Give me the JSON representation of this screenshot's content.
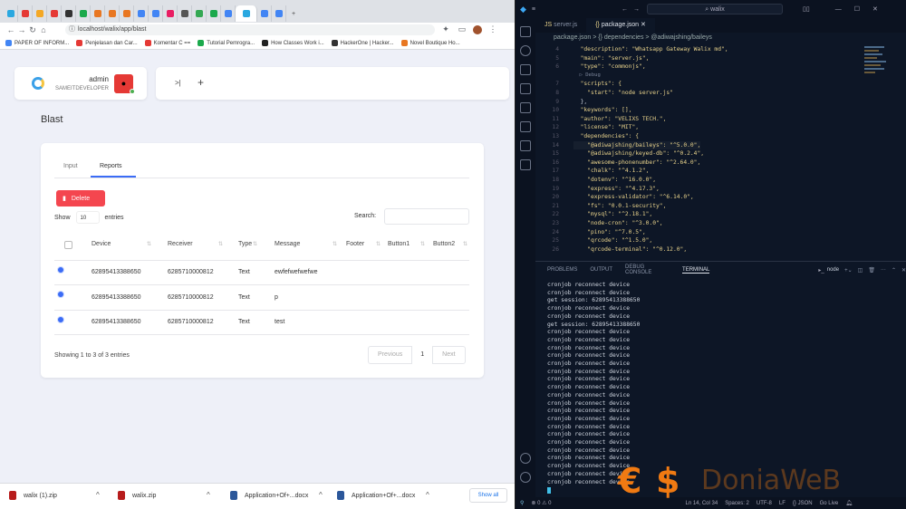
{
  "browser": {
    "tabs": [
      "",
      "",
      "",
      "",
      "",
      "",
      "",
      "",
      "",
      "",
      "",
      "",
      "",
      "",
      "",
      "S",
      "",
      "",
      "",
      ""
    ],
    "url": "localhost/walix/app/blast",
    "bookmarks": [
      "PAPER OF INFORM...",
      "Penjelasan dan Car...",
      "Komentar C ==",
      "Tutorial Pemrogra...",
      "How Classes Work i...",
      "HackerOne | Hacker...",
      "Novel Boutique Ho..."
    ]
  },
  "user": {
    "name": "admin",
    "role": "SAMEITDEVELOPER"
  },
  "actions": {
    "collapse": ">|",
    "add": "+"
  },
  "page": {
    "title": "Blast",
    "tabs": [
      "Input",
      "Reports"
    ],
    "delete_label": "Delete",
    "show_label": "Show",
    "entries_value": "10",
    "entries_label": "entries",
    "search_label": "Search:",
    "columns": [
      "Device",
      "Receiver",
      "Type",
      "Message",
      "Footer",
      "Button1",
      "Button2"
    ],
    "rows": [
      {
        "device": "62895413388650",
        "receiver": "6285710000812",
        "type": "Text",
        "message": "ewfefwefwefwe"
      },
      {
        "device": "62895413388650",
        "receiver": "6285710000812",
        "type": "Text",
        "message": "p"
      },
      {
        "device": "62895413388650",
        "receiver": "6285710000812",
        "type": "Text",
        "message": "test"
      }
    ],
    "info": "Showing 1 to 3 of 3 entries",
    "pager": {
      "prev": "Previous",
      "page": "1",
      "next": "Next"
    }
  },
  "downloads": {
    "items": [
      "walix (1).zip",
      "walix.zip",
      "Application+Of+...docx",
      "Application+Of+...docx"
    ],
    "show_all": "Show all"
  },
  "vscode": {
    "search": "walix",
    "tabs": [
      "server.js",
      "package.json"
    ],
    "breadcrumb": "package.json > {} dependencies > @adiwajshing/baileys",
    "code": [
      {
        "n": "4",
        "t": "  \"description\": \"Whatsapp Gateway Walix md\","
      },
      {
        "n": "5",
        "t": "  \"main\": \"server.js\","
      },
      {
        "n": "6",
        "t": "  \"type\": \"commonjs\","
      },
      {
        "n": "",
        "t": "  ▷ Debug"
      },
      {
        "n": "7",
        "t": "  \"scripts\": {"
      },
      {
        "n": "8",
        "t": "    \"start\": \"node server.js\""
      },
      {
        "n": "9",
        "t": "  },"
      },
      {
        "n": "10",
        "t": "  \"keywords\": [],"
      },
      {
        "n": "11",
        "t": "  \"author\": \"VELIXS TECH.\","
      },
      {
        "n": "12",
        "t": "  \"license\": \"MIT\","
      },
      {
        "n": "13",
        "t": "  \"dependencies\": {"
      },
      {
        "n": "14",
        "t": "    \"@adiwajshing/baileys\": \"^5.0.0\","
      },
      {
        "n": "15",
        "t": "    \"@adiwajshing/keyed-db\": \"^0.2.4\","
      },
      {
        "n": "16",
        "t": "    \"awesome-phonenumber\": \"^2.64.0\","
      },
      {
        "n": "17",
        "t": "    \"chalk\": \"^4.1.2\","
      },
      {
        "n": "18",
        "t": "    \"dotenv\": \"^16.0.0\","
      },
      {
        "n": "19",
        "t": "    \"express\": \"^4.17.3\","
      },
      {
        "n": "20",
        "t": "    \"express-validator\": \"^6.14.0\","
      },
      {
        "n": "21",
        "t": "    \"fs\": \"0.0.1-security\","
      },
      {
        "n": "22",
        "t": "    \"mysql\": \"^2.18.1\","
      },
      {
        "n": "23",
        "t": "    \"node-cron\": \"^3.0.0\","
      },
      {
        "n": "24",
        "t": "    \"pino\": \"^7.0.5\","
      },
      {
        "n": "25",
        "t": "    \"qrcode\": \"^1.5.0\","
      },
      {
        "n": "26",
        "t": "    \"qrcode-terminal\": \"^0.12.0\","
      }
    ],
    "panel_tabs": [
      "PROBLEMS",
      "OUTPUT",
      "DEBUG CONSOLE",
      "TERMINAL"
    ],
    "terminal_name": "node",
    "terminal": "cronjob reconnect device\ncronjob reconnect device\nget session: 62895413388650\ncronjob reconnect device\ncronjob reconnect device\nget session: 62895413388650\ncronjob reconnect device\ncronjob reconnect device\ncronjob reconnect device\ncronjob reconnect device\ncronjob reconnect device\ncronjob reconnect device\ncronjob reconnect device\ncronjob reconnect device\ncronjob reconnect device\ncronjob reconnect device\ncronjob reconnect device\ncronjob reconnect device\ncronjob reconnect device\ncronjob reconnect device\ncronjob reconnect device\ncronjob reconnect device\ncronjob reconnect device\ncronjob reconnect device\ncronjob reconnect device\ncronjob reconnect device",
    "status": {
      "errors": "⊗ 0 ⚠ 0",
      "position": "Ln 14, Col 34",
      "spaces": "Spaces: 2",
      "encoding": "UTF-8",
      "eol": "LF",
      "lang": "{} JSON",
      "live": "Go Live"
    }
  },
  "watermark": "DoniaWeB",
  "colors": {
    "accent": "#3b6cf6",
    "danger": "#f4464f",
    "terminal_bg": "#0d1626"
  }
}
